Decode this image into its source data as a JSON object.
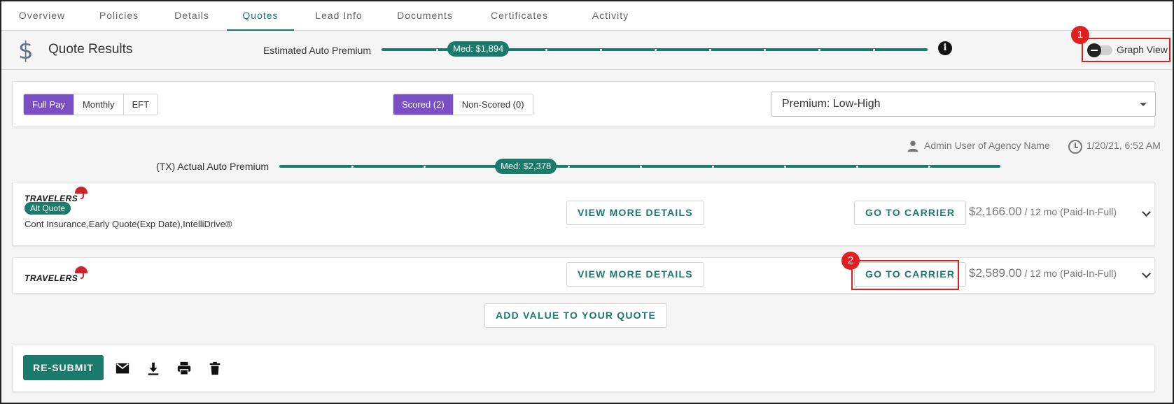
{
  "tabs": [
    {
      "label": "Overview"
    },
    {
      "label": "Policies"
    },
    {
      "label": "Details"
    },
    {
      "label": "Quotes"
    },
    {
      "label": "Lead Info"
    },
    {
      "label": "Documents"
    },
    {
      "label": "Certificates"
    },
    {
      "label": "Activity"
    }
  ],
  "active_tab": "Quotes",
  "header": {
    "title": "Quote Results",
    "estimated_label": "Estimated Auto Premium",
    "estimated_median": "Med: $1,894",
    "graph_view_label": "Graph View",
    "graph_view_on": false
  },
  "callouts": {
    "one": "1",
    "two": "2"
  },
  "filters": {
    "payment": [
      "Full Pay",
      "Monthly",
      "EFT"
    ],
    "payment_selected": "Full Pay",
    "score": [
      "Scored (2)",
      "Non-Scored (0)"
    ],
    "score_selected": "Scored (2)",
    "sort_value": "Premium: Low-High"
  },
  "meta": {
    "user": "Admin User of Agency Name",
    "timestamp": "1/20/21, 6:52 AM"
  },
  "actual": {
    "label": "(TX) Actual Auto Premium",
    "median": "Med: $2,378"
  },
  "quotes": [
    {
      "carrier": "TRAVELERS",
      "badge": "Alt Quote",
      "features": "Cont Insurance,Early Quote(Exp Date),IntelliDrive®",
      "details_label": "VIEW MORE DETAILS",
      "carrier_label": "GO TO CARRIER",
      "amount": "$2,166.00",
      "term": " / 12 mo (Paid-In-Full)"
    },
    {
      "carrier": "TRAVELERS",
      "details_label": "VIEW MORE DETAILS",
      "carrier_label": "GO TO CARRIER",
      "amount": "$2,589.00",
      "term": " / 12 mo (Paid-In-Full)"
    }
  ],
  "add_value_label": "ADD VALUE TO YOUR QUOTE",
  "footer": {
    "resubmit_label": "RE-SUBMIT",
    "icons": [
      "email-icon",
      "download-icon",
      "print-icon",
      "delete-icon"
    ]
  },
  "colors": {
    "accent": "#1a7a6c",
    "selected": "#7b4fc4",
    "callout": "#e02020",
    "brand_red": "#d0202a"
  }
}
